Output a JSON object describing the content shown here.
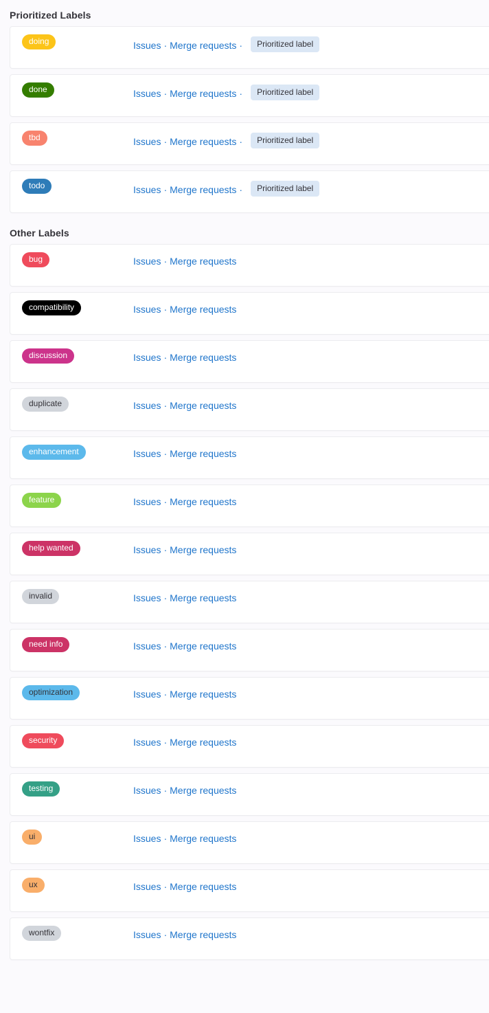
{
  "sections": [
    {
      "heading": "Prioritized Labels",
      "name": "prioritized-labels-section",
      "labels": [
        {
          "title": "doing",
          "bg": "#FCC419",
          "fg": "#ffffff",
          "issues_label": "Issues",
          "merge_requests_label": "Merge requests",
          "separator": "·",
          "trailing_separator": "·",
          "badge": "Prioritized label"
        },
        {
          "title": "done",
          "bg": "#347D00",
          "fg": "#ffffff",
          "issues_label": "Issues",
          "merge_requests_label": "Merge requests",
          "separator": "·",
          "trailing_separator": "·",
          "badge": "Prioritized label"
        },
        {
          "title": "tbd",
          "bg": "#F8836E",
          "fg": "#ffffff",
          "issues_label": "Issues",
          "merge_requests_label": "Merge requests",
          "separator": "·",
          "trailing_separator": "·",
          "badge": "Prioritized label"
        },
        {
          "title": "todo",
          "bg": "#2E7CB8",
          "fg": "#ffffff",
          "issues_label": "Issues",
          "merge_requests_label": "Merge requests",
          "separator": "·",
          "trailing_separator": "·",
          "badge": "Prioritized label"
        }
      ]
    },
    {
      "heading": "Other Labels",
      "name": "other-labels-section",
      "labels": [
        {
          "title": "bug",
          "bg": "#EF4B5C",
          "fg": "#ffffff",
          "issues_label": "Issues",
          "merge_requests_label": "Merge requests",
          "separator": "·",
          "trailing_separator": "",
          "badge": ""
        },
        {
          "title": "compatibility",
          "bg": "#000000",
          "fg": "#ffffff",
          "issues_label": "Issues",
          "merge_requests_label": "Merge requests",
          "separator": "·",
          "trailing_separator": "",
          "badge": ""
        },
        {
          "title": "discussion",
          "bg": "#CC338B",
          "fg": "#ffffff",
          "issues_label": "Issues",
          "merge_requests_label": "Merge requests",
          "separator": "·",
          "trailing_separator": "",
          "badge": ""
        },
        {
          "title": "duplicate",
          "bg": "#D1D5DB",
          "fg": "#333238",
          "issues_label": "Issues",
          "merge_requests_label": "Merge requests",
          "separator": "·",
          "trailing_separator": "",
          "badge": ""
        },
        {
          "title": "enhancement",
          "bg": "#5CB9EB",
          "fg": "#ffffff",
          "issues_label": "Issues",
          "merge_requests_label": "Merge requests",
          "separator": "·",
          "trailing_separator": "",
          "badge": ""
        },
        {
          "title": "feature",
          "bg": "#8CD44B",
          "fg": "#ffffff",
          "issues_label": "Issues",
          "merge_requests_label": "Merge requests",
          "separator": "·",
          "trailing_separator": "",
          "badge": ""
        },
        {
          "title": "help wanted",
          "bg": "#CC3366",
          "fg": "#ffffff",
          "issues_label": "Issues",
          "merge_requests_label": "Merge requests",
          "separator": "·",
          "trailing_separator": "",
          "badge": ""
        },
        {
          "title": "invalid",
          "bg": "#D1D5DB",
          "fg": "#333238",
          "issues_label": "Issues",
          "merge_requests_label": "Merge requests",
          "separator": "·",
          "trailing_separator": "",
          "badge": ""
        },
        {
          "title": "need info",
          "bg": "#CC3366",
          "fg": "#ffffff",
          "issues_label": "Issues",
          "merge_requests_label": "Merge requests",
          "separator": "·",
          "trailing_separator": "",
          "badge": ""
        },
        {
          "title": "optimization",
          "bg": "#5CB9EB",
          "fg": "#333238",
          "issues_label": "Issues",
          "merge_requests_label": "Merge requests",
          "separator": "·",
          "trailing_separator": "",
          "badge": ""
        },
        {
          "title": "security",
          "bg": "#EF4B5C",
          "fg": "#ffffff",
          "issues_label": "Issues",
          "merge_requests_label": "Merge requests",
          "separator": "·",
          "trailing_separator": "",
          "badge": ""
        },
        {
          "title": "testing",
          "bg": "#34A086",
          "fg": "#ffffff",
          "issues_label": "Issues",
          "merge_requests_label": "Merge requests",
          "separator": "·",
          "trailing_separator": "",
          "badge": ""
        },
        {
          "title": "ui",
          "bg": "#F9AE6A",
          "fg": "#333238",
          "issues_label": "Issues",
          "merge_requests_label": "Merge requests",
          "separator": "·",
          "trailing_separator": "",
          "badge": ""
        },
        {
          "title": "ux",
          "bg": "#F9AE6A",
          "fg": "#333238",
          "issues_label": "Issues",
          "merge_requests_label": "Merge requests",
          "separator": "·",
          "trailing_separator": "",
          "badge": ""
        },
        {
          "title": "wontfix",
          "bg": "#D1D5DB",
          "fg": "#333238",
          "issues_label": "Issues",
          "merge_requests_label": "Merge requests",
          "separator": "·",
          "trailing_separator": "",
          "badge": ""
        }
      ]
    }
  ],
  "theme": {
    "page_background": "#fbfafd",
    "card_background": "#ffffff",
    "card_border": "#ececef",
    "link_color": "#1f75cb",
    "heading_color": "#333238",
    "prioritized_badge_background": "#dbe7f5"
  }
}
